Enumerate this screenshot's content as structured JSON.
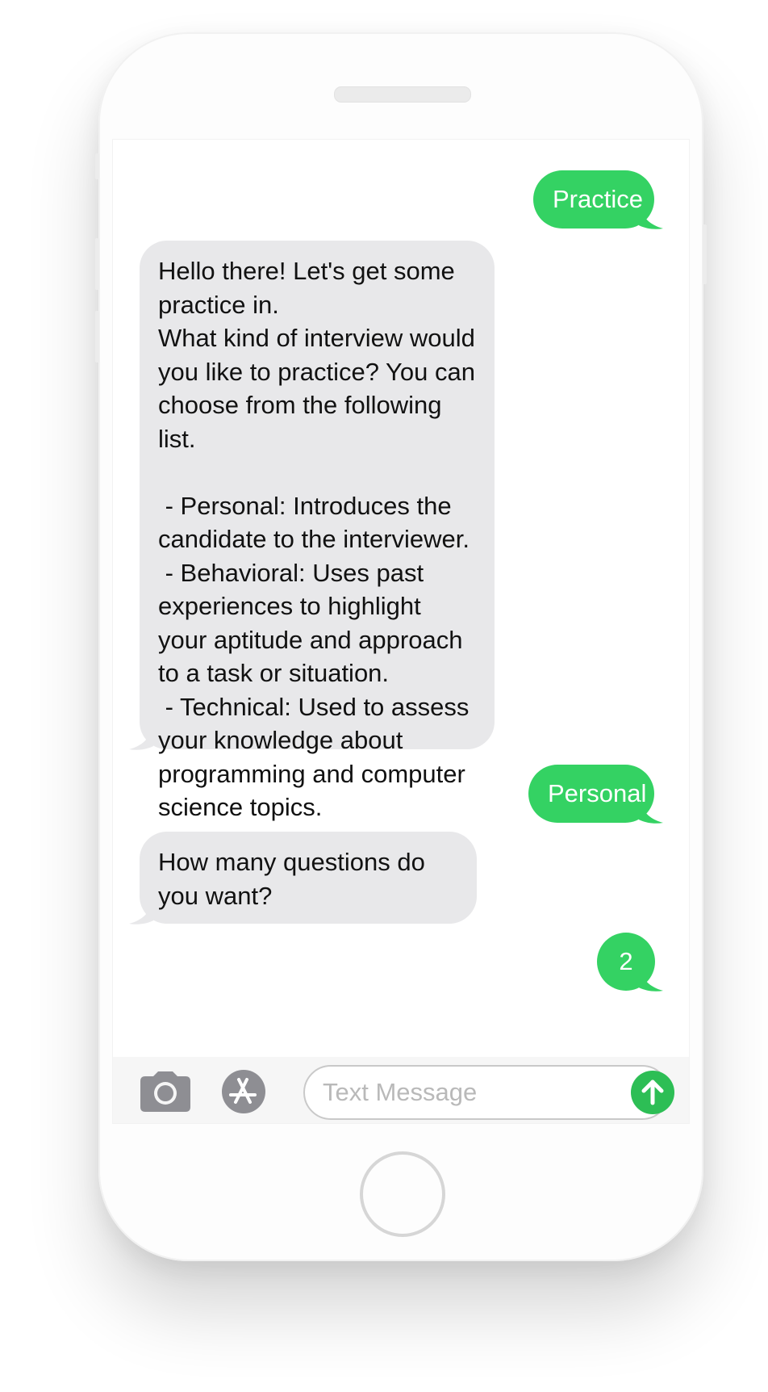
{
  "conversation": {
    "messages": [
      {
        "direction": "outgoing",
        "text": "Practice"
      },
      {
        "direction": "incoming",
        "text": "Hello there! Let's get some practice in.\nWhat kind of interview would you like to practice? You can choose from the following list.\n\n - Personal: Introduces the candidate to the interviewer.\n - Behavioral: Uses past experiences to highlight your aptitude and approach to a task or situation.\n - Technical: Used to assess your knowledge about programming and computer science topics."
      },
      {
        "direction": "outgoing",
        "text": "Personal"
      },
      {
        "direction": "incoming",
        "text": "How many questions do you want?"
      },
      {
        "direction": "outgoing",
        "text": "2"
      }
    ]
  },
  "composer": {
    "placeholder": "Text Message",
    "value": "",
    "camera_icon": "camera-icon",
    "apps_icon": "app-store-icon",
    "send_icon": "arrow-up-icon"
  },
  "colors": {
    "outgoing_bubble": "#34d263",
    "incoming_bubble": "#e8e8ea",
    "send_button": "#2dbe55"
  }
}
